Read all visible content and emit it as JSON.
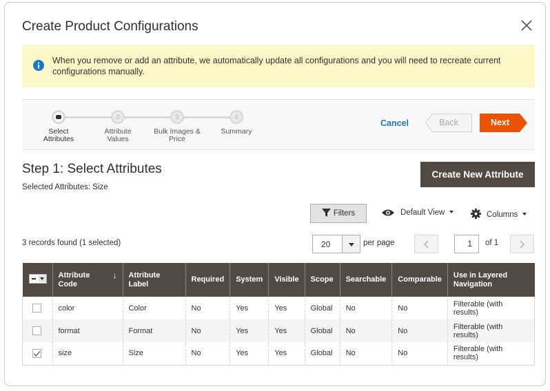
{
  "modal": {
    "title": "Create Product Configurations",
    "notice": "When you remove or add an attribute, we automatically update all configurations and you will need to recreate current configurations manually."
  },
  "wizard": {
    "steps": [
      {
        "number": "",
        "label_line1": "Select",
        "label_line2": "Attributes",
        "active": true
      },
      {
        "number": "2",
        "label_line1": "Attribute",
        "label_line2": "Values",
        "active": false
      },
      {
        "number": "3",
        "label_line1": "Bulk Images &",
        "label_line2": "Price",
        "active": false
      },
      {
        "number": "4",
        "label_line1": "Summary",
        "label_line2": "",
        "active": false
      }
    ],
    "cancel_label": "Cancel",
    "back_label": "Back",
    "next_label": "Next"
  },
  "step_content": {
    "title": "Step 1: Select Attributes",
    "selected_attributes": "Selected Attributes: Size",
    "create_button": "Create New Attribute"
  },
  "toolbar": {
    "filters_label": "Filters",
    "view_label": "Default View",
    "columns_label": "Columns",
    "records_found": "3 records found (1 selected)",
    "per_page_value": "20",
    "per_page_label": "per page",
    "current_page": "1",
    "page_of": "of 1"
  },
  "grid": {
    "sort_indicator": "↓",
    "columns": [
      {
        "line1": "Attribute",
        "line2": "Code"
      },
      {
        "line1": "Attribute",
        "line2": "Label"
      },
      {
        "line1": "Required",
        "line2": ""
      },
      {
        "line1": "System",
        "line2": ""
      },
      {
        "line1": "Visible",
        "line2": ""
      },
      {
        "line1": "Scope",
        "line2": ""
      },
      {
        "line1": "Searchable",
        "line2": ""
      },
      {
        "line1": "Comparable",
        "line2": ""
      },
      {
        "line1": "Use in Layered",
        "line2": "Navigation"
      }
    ],
    "rows": [
      {
        "checked": false,
        "cells": [
          "color",
          "Color",
          "No",
          "Yes",
          "Yes",
          "Global",
          "No",
          "No",
          "Filterable (with results)"
        ]
      },
      {
        "checked": false,
        "cells": [
          "format",
          "Format",
          "No",
          "Yes",
          "Yes",
          "Global",
          "No",
          "No",
          "Filterable (with results)"
        ]
      },
      {
        "checked": true,
        "cells": [
          "size",
          "Size",
          "No",
          "Yes",
          "Yes",
          "Global",
          "No",
          "No",
          "Filterable (with results)"
        ]
      }
    ]
  },
  "colors": {
    "accent_orange": "#eb5202",
    "header_dark": "#514943",
    "link_blue": "#1979c3",
    "notice_bg": "#fdf8c8",
    "info_icon": "#1979c3"
  },
  "icons": {
    "close": "close-icon",
    "info": "info-icon",
    "filter": "funnel-icon",
    "view": "eye-icon",
    "columns": "gear-icon",
    "prev": "chevron-left-icon",
    "next": "chevron-right-icon"
  }
}
